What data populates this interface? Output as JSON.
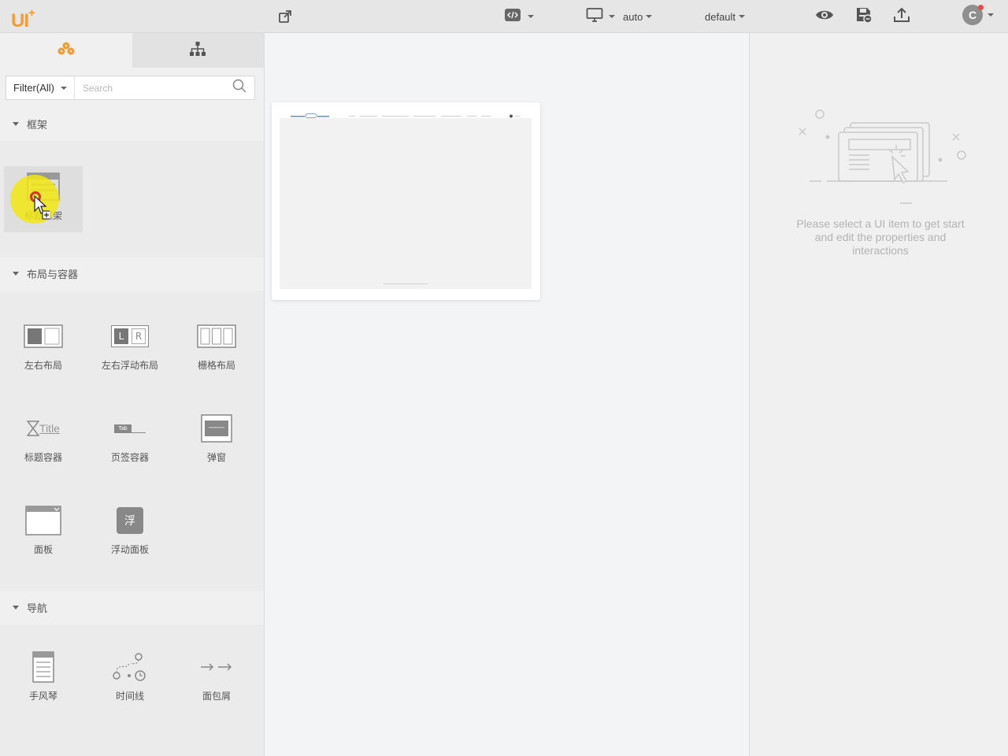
{
  "app": {
    "logo_text": "UI",
    "logo_mark": "+",
    "accent_color": "#f39c34"
  },
  "toolbar": {
    "external_link_icon": "external-link-icon",
    "code_icon": "code-icon",
    "device_label": "auto",
    "theme_label": "default",
    "preview_icon": "eye-icon",
    "save_icon": "save-icon",
    "export_icon": "export-icon",
    "user_initial": "C",
    "notification_color": "#e34b4b"
  },
  "left_panel": {
    "tabs": [
      {
        "name": "components",
        "icon": "components-icon",
        "active": true
      },
      {
        "name": "structure",
        "icon": "sitemap-icon",
        "active": false
      }
    ],
    "filter_label": "Filter(All)",
    "search_placeholder": "Search",
    "sections": [
      {
        "title": "框架",
        "items": [
          {
            "label": "标题框架",
            "icon": "title-frame-icon"
          }
        ]
      },
      {
        "title": "布局与容器",
        "items": [
          {
            "label": "左右布局",
            "icon": "left-right-layout-icon"
          },
          {
            "label": "左右浮动布局",
            "icon": "float-layout-icon",
            "icon_text_l": "L",
            "icon_text_r": "R"
          },
          {
            "label": "栅格布局",
            "icon": "grid-layout-icon"
          },
          {
            "label": "标题容器",
            "icon": "title-container-icon",
            "icon_text": "Title"
          },
          {
            "label": "页签容器",
            "icon": "tab-container-icon",
            "icon_text": "Tab"
          },
          {
            "label": "弹窗",
            "icon": "dialog-icon"
          },
          {
            "label": "面板",
            "icon": "panel-icon"
          },
          {
            "label": "浮动面板",
            "icon": "float-panel-icon",
            "icon_text": "浮"
          }
        ]
      },
      {
        "title": "导航",
        "items": [
          {
            "label": "手风琴",
            "icon": "accordion-icon"
          },
          {
            "label": "时间线",
            "icon": "timeline-icon"
          },
          {
            "label": "面包屑",
            "icon": "breadcrumb-icon"
          }
        ]
      }
    ]
  },
  "canvas": {
    "page_thumbnail_icon": "page-thumbnail"
  },
  "right_panel": {
    "empty_message": "Please select a UI item to get start and edit the properties and interactions",
    "illustration_icon": "select-item-illustration"
  }
}
